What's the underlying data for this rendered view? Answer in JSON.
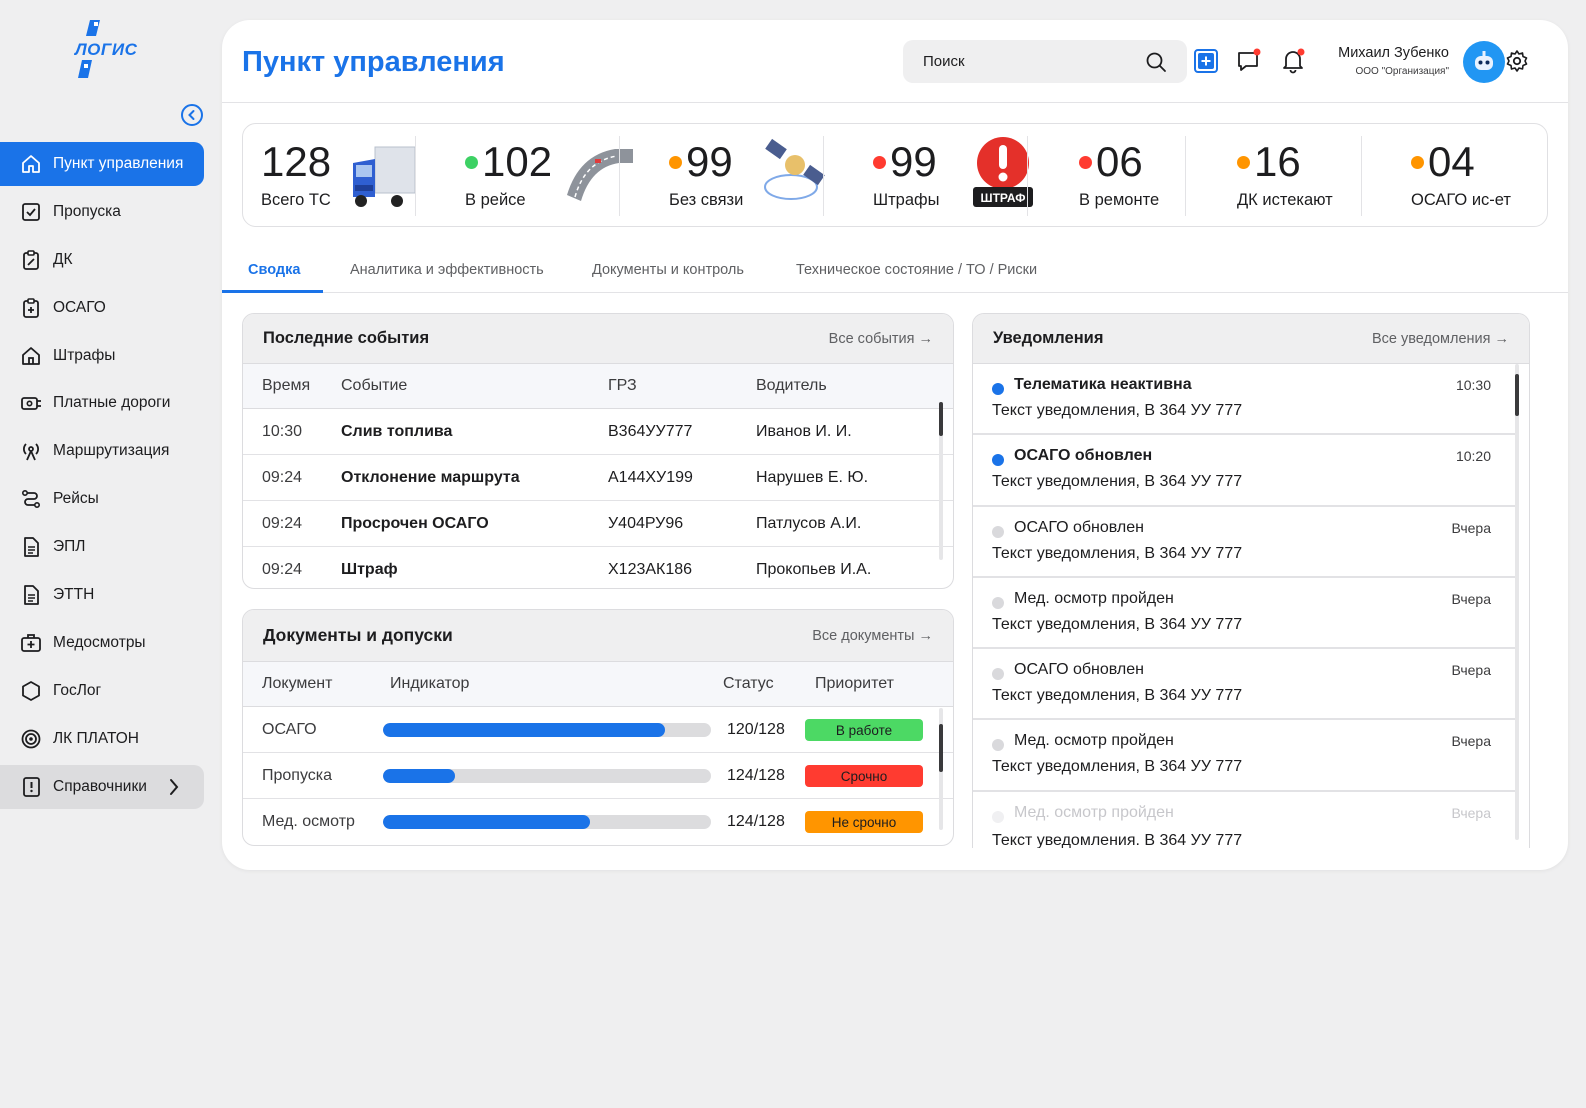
{
  "app": {
    "logo_text": "ЛОГИС"
  },
  "sidebar": {
    "items": [
      {
        "label": "Пункт управления",
        "icon": "home-icon"
      },
      {
        "label": "Пропуска",
        "icon": "checkbox-icon"
      },
      {
        "label": "ДК",
        "icon": "clipboard-wrench-icon"
      },
      {
        "label": "ОСАГО",
        "icon": "clipboard-plus-icon"
      },
      {
        "label": "Штрафы",
        "icon": "house-fine-icon"
      },
      {
        "label": "Платные дороги",
        "icon": "toll-road-icon"
      },
      {
        "label": "Маршрутизация",
        "icon": "antenna-icon"
      },
      {
        "label": "Рейсы",
        "icon": "route-icon"
      },
      {
        "label": "ЭПЛ",
        "icon": "document-icon"
      },
      {
        "label": "ЭТТН",
        "icon": "document-icon"
      },
      {
        "label": "Медосмотры",
        "icon": "medkit-icon"
      },
      {
        "label": "ГосЛог",
        "icon": "hexagon-icon"
      },
      {
        "label": "ЛК ПЛАТОН",
        "icon": "target-icon"
      },
      {
        "label": "Справочники",
        "icon": "alert-book-icon"
      }
    ]
  },
  "header": {
    "title": "Пункт управления",
    "search_placeholder": "Поиск",
    "user_name": "Михаил Зубенко",
    "user_org": "ООО \"Организация\""
  },
  "stats": [
    {
      "value": "128",
      "label": "Всего ТС",
      "dot": "",
      "art": "truck"
    },
    {
      "value": "102",
      "label": "В рейсе",
      "dot": "#3dd164",
      "art": "road"
    },
    {
      "value": "99",
      "label": "Без связи",
      "dot": "#ff9500",
      "art": "satellite"
    },
    {
      "value": "99",
      "label": "Штрафы",
      "dot": "#ff3b30",
      "art": "fine"
    },
    {
      "value": "06",
      "label": "В ремонте",
      "dot": "#ff3b30",
      "art": ""
    },
    {
      "value": "16",
      "label": "ДК истекают",
      "dot": "#ff9500",
      "art": ""
    },
    {
      "value": "04",
      "label": "ОСАГО ис-ет",
      "dot": "#ff9500",
      "art": ""
    }
  ],
  "fine_badge": "ШТРАФ",
  "tabs": [
    "Сводка",
    "Аналитика и эффективность",
    "Документы и контроль",
    "Техническое состояние / ТО / Риски"
  ],
  "events": {
    "title": "Последние события",
    "link": "Все события →",
    "columns": [
      "Время",
      "Событие",
      "ГРЗ",
      "Водитель"
    ],
    "rows": [
      [
        "10:30",
        "Слив топлива",
        "В364УУ777",
        "Иванов И. И."
      ],
      [
        "09:24",
        "Отклонение маршрута",
        "А144ХУ199",
        "Нарушев Е. Ю."
      ],
      [
        "09:24",
        "Просрочен ОСАГО",
        "У404РУ96",
        "Патлусов А.И."
      ],
      [
        "09:24",
        "Штраф",
        "Х123АК186",
        "Прокопьев И.А."
      ]
    ]
  },
  "documents": {
    "title": "Документы и допуски",
    "link": "Все документы →",
    "columns": [
      "Локумент",
      "Индикатор",
      "Статус",
      "Приоритет"
    ],
    "rows": [
      {
        "name": "ОСАГО",
        "progress": 0.86,
        "status": "120/128",
        "priority": "В работе",
        "color": "#4cd964"
      },
      {
        "name": "Пропуска",
        "progress": 0.22,
        "status": "124/128",
        "priority": "Срочно",
        "color": "#ff3b30"
      },
      {
        "name": "Мед. осмотр",
        "progress": 0.63,
        "status": "124/128",
        "priority": "Не срочно",
        "color": "#ff9500"
      }
    ]
  },
  "notifications": {
    "title": "Уведомления",
    "link": "Все уведомления →",
    "items": [
      {
        "title": "Телематика неактивна",
        "text": "Текст уведомления, В 364 УУ 777",
        "time": "10:30",
        "unread": true
      },
      {
        "title": "ОСАГО обновлен",
        "text": "Текст уведомления, В 364 УУ 777",
        "time": "10:20",
        "unread": true
      },
      {
        "title": "ОСАГО обновлен",
        "text": "Текст уведомления, В 364 УУ 777",
        "time": "Вчера",
        "unread": false
      },
      {
        "title": "Мед. осмотр пройден",
        "text": "Текст уведомления, В 364 УУ 777",
        "time": "Вчера",
        "unread": false
      },
      {
        "title": "ОСАГО обновлен",
        "text": "Текст уведомления, В 364 УУ 777",
        "time": "Вчера",
        "unread": false
      },
      {
        "title": "Мед. осмотр пройден",
        "text": "Текст уведомления, В 364 УУ 777",
        "time": "Вчера",
        "unread": false
      },
      {
        "title": "Мед. осмотр пройден",
        "text": "Текст уведомления. В 364 УУ 777",
        "time": "Вчера",
        "unread": false
      }
    ]
  },
  "colors": {
    "accent": "#1a73e8",
    "unread": "#1a73e8",
    "read": "#d9d9dc"
  }
}
